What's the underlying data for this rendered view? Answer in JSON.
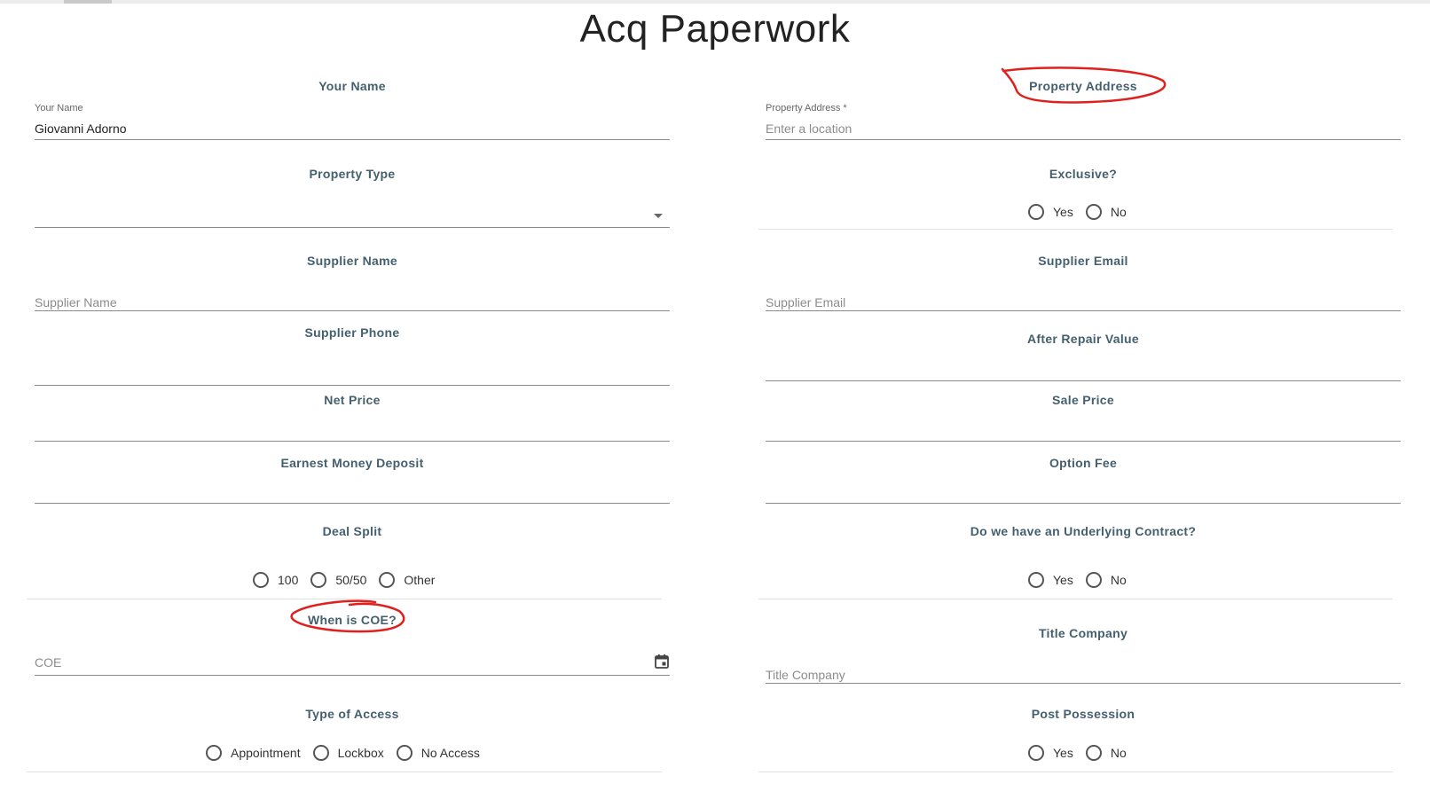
{
  "page": {
    "title": "Acq Paperwork"
  },
  "colors": {
    "label": "#44606f",
    "annotation": "#e0201c",
    "underline": "#8a8a8a"
  },
  "left": {
    "your_name": {
      "label": "Your Name",
      "float_label": "Your Name",
      "value": "Giovanni Adorno"
    },
    "property_type": {
      "label": "Property Type",
      "value": ""
    },
    "supplier_name": {
      "label": "Supplier Name",
      "placeholder": "Supplier Name"
    },
    "supplier_phone": {
      "label": "Supplier Phone"
    },
    "net_price": {
      "label": "Net Price"
    },
    "earnest_money": {
      "label": "Earnest Money Deposit"
    },
    "deal_split": {
      "label": "Deal Split",
      "options": [
        "100",
        "50/50",
        "Other"
      ]
    },
    "coe": {
      "label": "When is COE?",
      "placeholder": "COE",
      "icon": "calendar-icon"
    },
    "access": {
      "label": "Type of Access",
      "options": [
        "Appointment",
        "Lockbox",
        "No Access"
      ]
    }
  },
  "right": {
    "property_address": {
      "label": "Property Address",
      "float_label": "Property Address *",
      "placeholder": "Enter a location"
    },
    "exclusive": {
      "label": "Exclusive?",
      "options": [
        "Yes",
        "No"
      ]
    },
    "supplier_email": {
      "label": "Supplier Email",
      "placeholder": "Supplier Email"
    },
    "arv": {
      "label": "After Repair Value"
    },
    "sale_price": {
      "label": "Sale Price"
    },
    "option_fee": {
      "label": "Option Fee"
    },
    "underlying": {
      "label": "Do we have an Underlying Contract?",
      "options": [
        "Yes",
        "No"
      ]
    },
    "title_company": {
      "label": "Title Company",
      "placeholder": "Title Company"
    },
    "post_possession": {
      "label": "Post Possession",
      "options": [
        "Yes",
        "No"
      ]
    }
  }
}
